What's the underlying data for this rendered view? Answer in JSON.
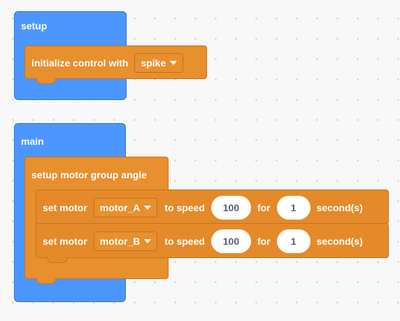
{
  "setup": {
    "label": "setup",
    "init_label": "initialize control with",
    "control_value": "spike"
  },
  "main": {
    "label": "main",
    "group_label": "setup motor group angle",
    "motors": [
      {
        "set_label": "set motor",
        "motor": "motor_A",
        "to_speed_label": "to speed",
        "speed": "100",
        "for_label": "for",
        "duration": "1",
        "unit_label": "second(s)"
      },
      {
        "set_label": "set motor",
        "motor": "motor_B",
        "to_speed_label": "to speed",
        "speed": "100",
        "for_label": "for",
        "duration": "1",
        "unit_label": "second(s)"
      }
    ]
  },
  "colors": {
    "hat": "#4C97FF",
    "block": "#E88F2E",
    "canvas": "#F8F8F8"
  }
}
